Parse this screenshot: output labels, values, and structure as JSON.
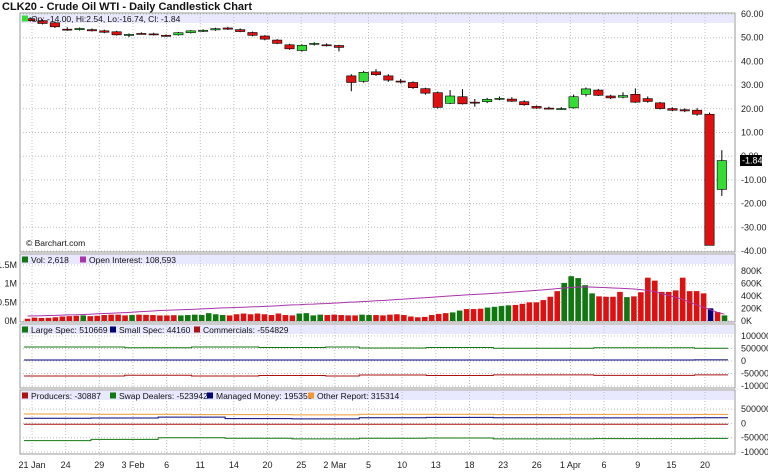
{
  "title": "CLK20 - Crude Oil WTI - Daily Candlestick Chart",
  "price_legend": "Op: -14.00, Hi:2.54, Lo:-16.74, Cl: -1.84",
  "last_price": "-1.84",
  "watermark": "© Barchart.com",
  "colors": {
    "up": "#33dd33",
    "down": "#dd1111",
    "oi": "#aa33aa",
    "panel": "#e8e8ff",
    "grid": "#bfbfbf"
  },
  "chart_data": [
    {
      "type": "candlestick",
      "title": "CLK20 - Crude Oil WTI - Daily Candlestick Chart",
      "y_ticks": [
        "60.00",
        "50.00",
        "40.00",
        "30.00",
        "20.00",
        "10.00",
        "0.00",
        "-10.00",
        "-20.00",
        "-30.00",
        "-40.00"
      ],
      "ylim": [
        -40,
        60
      ],
      "x_labels": [
        "21 Jan",
        "24",
        "29",
        "3 Feb",
        "6",
        "11",
        "14",
        "20",
        "25",
        "2 Mar",
        "5",
        "10",
        "13",
        "18",
        "23",
        "26",
        "1 Apr",
        "6",
        "9",
        "15",
        "20"
      ],
      "candles": [
        {
          "o": 58.0,
          "h": 58.6,
          "l": 56.8,
          "c": 57.2
        },
        {
          "o": 57.2,
          "h": 57.8,
          "l": 55.6,
          "c": 56.0
        },
        {
          "o": 56.3,
          "h": 56.8,
          "l": 54.1,
          "c": 54.6
        },
        {
          "o": 53.6,
          "h": 54.4,
          "l": 52.9,
          "c": 53.2
        },
        {
          "o": 53.4,
          "h": 54.3,
          "l": 53.0,
          "c": 53.9
        },
        {
          "o": 53.4,
          "h": 53.9,
          "l": 52.6,
          "c": 52.9
        },
        {
          "o": 52.9,
          "h": 53.4,
          "l": 51.9,
          "c": 52.3
        },
        {
          "o": 52.5,
          "h": 52.9,
          "l": 50.9,
          "c": 51.2
        },
        {
          "o": 51.0,
          "h": 51.8,
          "l": 50.3,
          "c": 51.4
        },
        {
          "o": 51.8,
          "h": 52.3,
          "l": 51.3,
          "c": 51.7
        },
        {
          "o": 51.6,
          "h": 52.1,
          "l": 50.9,
          "c": 51.2
        },
        {
          "o": 51.0,
          "h": 51.4,
          "l": 50.4,
          "c": 50.7
        },
        {
          "o": 51.2,
          "h": 52.4,
          "l": 50.9,
          "c": 52.1
        },
        {
          "o": 52.1,
          "h": 53.2,
          "l": 51.8,
          "c": 52.9
        },
        {
          "o": 53.1,
          "h": 53.6,
          "l": 52.4,
          "c": 53.1
        },
        {
          "o": 53.3,
          "h": 54.2,
          "l": 52.9,
          "c": 53.8
        },
        {
          "o": 54.1,
          "h": 54.6,
          "l": 53.3,
          "c": 53.6
        },
        {
          "o": 53.4,
          "h": 53.9,
          "l": 52.3,
          "c": 52.6
        },
        {
          "o": 52.2,
          "h": 52.6,
          "l": 50.6,
          "c": 51.0
        },
        {
          "o": 50.7,
          "h": 51.1,
          "l": 48.9,
          "c": 49.4
        },
        {
          "o": 49.0,
          "h": 49.4,
          "l": 47.3,
          "c": 47.6
        },
        {
          "o": 47.0,
          "h": 47.4,
          "l": 44.9,
          "c": 45.3
        },
        {
          "o": 44.6,
          "h": 47.2,
          "l": 44.1,
          "c": 46.8
        },
        {
          "o": 47.3,
          "h": 48.1,
          "l": 46.7,
          "c": 47.6
        },
        {
          "o": 47.0,
          "h": 47.6,
          "l": 46.3,
          "c": 46.8
        },
        {
          "o": 46.7,
          "h": 47.0,
          "l": 44.2,
          "c": 45.9
        },
        {
          "o": 33.9,
          "h": 34.6,
          "l": 27.4,
          "c": 31.1
        },
        {
          "o": 31.6,
          "h": 36.0,
          "l": 31.0,
          "c": 35.4
        },
        {
          "o": 35.6,
          "h": 36.7,
          "l": 33.9,
          "c": 34.4
        },
        {
          "o": 33.9,
          "h": 34.6,
          "l": 31.4,
          "c": 32.1
        },
        {
          "o": 31.7,
          "h": 32.6,
          "l": 30.7,
          "c": 31.5
        },
        {
          "o": 31.1,
          "h": 31.6,
          "l": 28.4,
          "c": 28.9
        },
        {
          "o": 28.5,
          "h": 28.9,
          "l": 26.0,
          "c": 26.6
        },
        {
          "o": 26.8,
          "h": 27.3,
          "l": 20.1,
          "c": 20.6
        },
        {
          "o": 22.3,
          "h": 27.9,
          "l": 22.0,
          "c": 25.4
        },
        {
          "o": 25.1,
          "h": 28.3,
          "l": 21.8,
          "c": 22.1
        },
        {
          "o": 22.8,
          "h": 24.1,
          "l": 20.9,
          "c": 22.6
        },
        {
          "o": 23.0,
          "h": 24.6,
          "l": 22.4,
          "c": 24.0
        },
        {
          "o": 24.3,
          "h": 25.2,
          "l": 23.6,
          "c": 24.4
        },
        {
          "o": 24.1,
          "h": 24.9,
          "l": 22.9,
          "c": 23.2
        },
        {
          "o": 23.0,
          "h": 23.6,
          "l": 21.3,
          "c": 21.7
        },
        {
          "o": 21.0,
          "h": 21.4,
          "l": 20.0,
          "c": 20.3
        },
        {
          "o": 20.3,
          "h": 20.9,
          "l": 19.7,
          "c": 20.1
        },
        {
          "o": 20.1,
          "h": 20.7,
          "l": 19.6,
          "c": 20.1
        },
        {
          "o": 20.4,
          "h": 26.0,
          "l": 20.1,
          "c": 25.1
        },
        {
          "o": 26.1,
          "h": 29.0,
          "l": 25.2,
          "c": 28.4
        },
        {
          "o": 27.9,
          "h": 28.4,
          "l": 25.4,
          "c": 25.7
        },
        {
          "o": 25.4,
          "h": 25.9,
          "l": 24.1,
          "c": 24.6
        },
        {
          "o": 24.9,
          "h": 27.0,
          "l": 24.4,
          "c": 25.6
        },
        {
          "o": 26.1,
          "h": 28.6,
          "l": 22.5,
          "c": 22.8
        },
        {
          "o": 24.3,
          "h": 25.2,
          "l": 22.6,
          "c": 23.1
        },
        {
          "o": 22.5,
          "h": 22.9,
          "l": 19.7,
          "c": 20.1
        },
        {
          "o": 20.1,
          "h": 20.6,
          "l": 19.0,
          "c": 19.4
        },
        {
          "o": 19.6,
          "h": 20.2,
          "l": 18.6,
          "c": 19.1
        },
        {
          "o": 19.4,
          "h": 20.3,
          "l": 17.1,
          "c": 17.7
        },
        {
          "o": 17.7,
          "h": 18.4,
          "l": -37.6,
          "c": -37.6
        },
        {
          "o": -14.0,
          "h": 2.54,
          "l": -16.74,
          "c": -1.84
        }
      ]
    },
    {
      "type": "bar",
      "title": "Volume / Open Interest",
      "series_labels": [
        "Vol: 2,618",
        "Open Interest: 108,593"
      ],
      "y_ticks_left": [
        "1.5M",
        "1M",
        "0.5M",
        "0M"
      ],
      "y_ticks_right": [
        "800K",
        "600K",
        "400K",
        "200K",
        "0K"
      ],
      "volume_k": [
        60,
        90,
        80,
        85,
        100,
        120,
        130,
        140,
        150,
        130,
        140,
        160,
        170,
        170,
        150,
        160,
        170,
        165,
        160,
        150,
        150,
        155,
        150,
        160,
        170,
        160,
        210,
        180,
        160,
        150,
        180,
        200,
        180,
        200,
        180,
        160,
        200,
        160,
        150,
        200,
        210,
        150,
        170,
        160,
        170,
        160,
        150,
        150,
        170,
        160,
        160,
        150,
        170,
        180,
        160,
        120,
        100,
        110,
        160,
        190,
        210,
        230,
        280,
        320,
        320,
        330,
        360,
        380,
        400,
        420,
        430,
        460,
        500,
        500,
        560,
        650,
        800,
        1020,
        1200,
        1150,
        960,
        740,
        660,
        650,
        650,
        780,
        640,
        660,
        770,
        1160,
        1080,
        780,
        780,
        820,
        1160,
        800,
        800,
        740,
        340,
        240,
        150
      ],
      "oi_k": [
        80,
        82,
        85,
        88,
        90,
        95,
        98,
        100,
        105,
        110,
        115,
        120,
        125,
        130,
        135,
        140,
        148,
        155,
        160,
        168,
        172,
        176,
        180,
        185,
        190,
        195,
        200,
        205,
        210,
        214,
        218,
        222,
        226,
        230,
        235,
        240,
        246,
        252,
        258,
        262,
        268,
        272,
        278,
        282,
        288,
        294,
        300,
        305,
        312,
        318,
        325,
        330,
        338,
        345,
        352,
        360,
        368,
        375,
        382,
        390,
        398,
        405,
        412,
        420,
        426,
        432,
        438,
        445,
        452,
        460,
        468,
        476,
        484,
        492,
        500,
        510,
        520,
        530,
        538,
        545,
        548,
        545,
        540,
        536,
        530,
        525,
        520,
        515,
        505,
        490,
        470,
        440,
        410,
        380,
        350,
        300,
        260,
        220,
        180,
        140,
        110
      ]
    },
    {
      "type": "line",
      "title": "Commitment of Traders",
      "series_labels": [
        "Large Spec: 510669",
        "Small Spec: 44160",
        "Commercials: -554829"
      ],
      "y_ticks": [
        "1000000",
        "500000",
        "0",
        "-500000",
        "-1000000"
      ],
      "series": [
        {
          "name": "Large Spec",
          "color": "#117711",
          "values": [
            560000,
            560000,
            560000,
            530000,
            530000,
            560000,
            560000,
            540000,
            540000,
            560000,
            520000,
            520000,
            540000,
            540000,
            510000,
            510000,
            510000,
            530000,
            530000,
            530000,
            510669
          ]
        },
        {
          "name": "Small Spec",
          "color": "#000077",
          "values": [
            40000,
            40000,
            40000,
            40000,
            40000,
            40000,
            40000,
            40000,
            40000,
            40000,
            40000,
            40000,
            40000,
            40000,
            40000,
            40000,
            40000,
            40000,
            40000,
            40000,
            44160
          ]
        },
        {
          "name": "Commercials",
          "color": "#aa1111",
          "values": [
            -600000,
            -600000,
            -600000,
            -570000,
            -570000,
            -600000,
            -600000,
            -580000,
            -580000,
            -600000,
            -560000,
            -560000,
            -580000,
            -580000,
            -555000,
            -555000,
            -555000,
            -575000,
            -575000,
            -575000,
            -554829
          ]
        }
      ]
    },
    {
      "type": "line",
      "title": "Commitment of Traders (disaggregated)",
      "series_labels": [
        "Producers: -30887",
        "Swap Dealers: -523942",
        "Managed Money: 195355",
        "Other Report: 315314"
      ],
      "y_ticks": [
        "500000",
        "0",
        "-500000",
        "-1000000"
      ],
      "series": [
        {
          "name": "Producers",
          "color": "#aa1111",
          "values": [
            -30000,
            -30000,
            -30000,
            -30000,
            -30000,
            -30000,
            -30000,
            -30000,
            -30000,
            -30000,
            -30000,
            -30000,
            -30000,
            -30000,
            -30000,
            -30000,
            -30000,
            -30000,
            -30000,
            -30000,
            -30887
          ]
        },
        {
          "name": "Swap Dealers",
          "color": "#117711",
          "values": [
            -600000,
            -600000,
            -560000,
            -560000,
            -500000,
            -500000,
            -520000,
            -520000,
            -540000,
            -540000,
            -520000,
            -520000,
            -510000,
            -510000,
            -540000,
            -540000,
            -540000,
            -530000,
            -530000,
            -530000,
            -523942
          ]
        },
        {
          "name": "Managed Money",
          "color": "#000077",
          "values": [
            180000,
            180000,
            190000,
            190000,
            220000,
            220000,
            170000,
            170000,
            160000,
            160000,
            200000,
            200000,
            210000,
            210000,
            200000,
            200000,
            195000,
            195000,
            195000,
            195000,
            195355
          ]
        },
        {
          "name": "Other Report",
          "color": "#ee9933",
          "values": [
            330000,
            330000,
            320000,
            320000,
            320000,
            310000,
            310000,
            310000,
            300000,
            300000,
            320000,
            320000,
            320000,
            320000,
            310000,
            310000,
            315000,
            315000,
            315000,
            315000,
            315314
          ]
        }
      ]
    }
  ]
}
